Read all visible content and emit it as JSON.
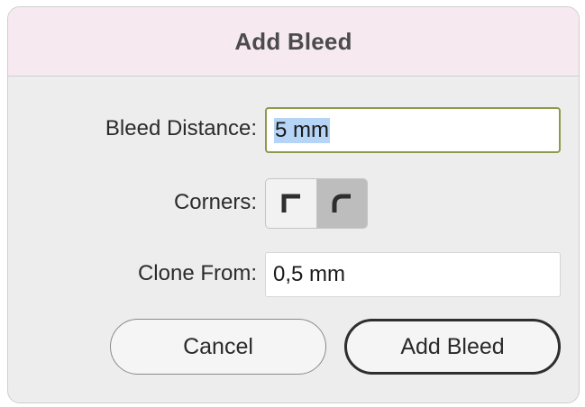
{
  "dialog": {
    "title": "Add Bleed",
    "bleed_distance": {
      "label": "Bleed Distance:",
      "value": "5 mm"
    },
    "corners": {
      "label": "Corners:",
      "options": [
        {
          "icon": "square-corner-icon",
          "selected": false
        },
        {
          "icon": "round-corner-icon",
          "selected": true
        }
      ]
    },
    "clone_from": {
      "label": "Clone From:",
      "value": "0,5 mm"
    },
    "buttons": {
      "cancel": "Cancel",
      "add": "Add Bleed"
    }
  }
}
